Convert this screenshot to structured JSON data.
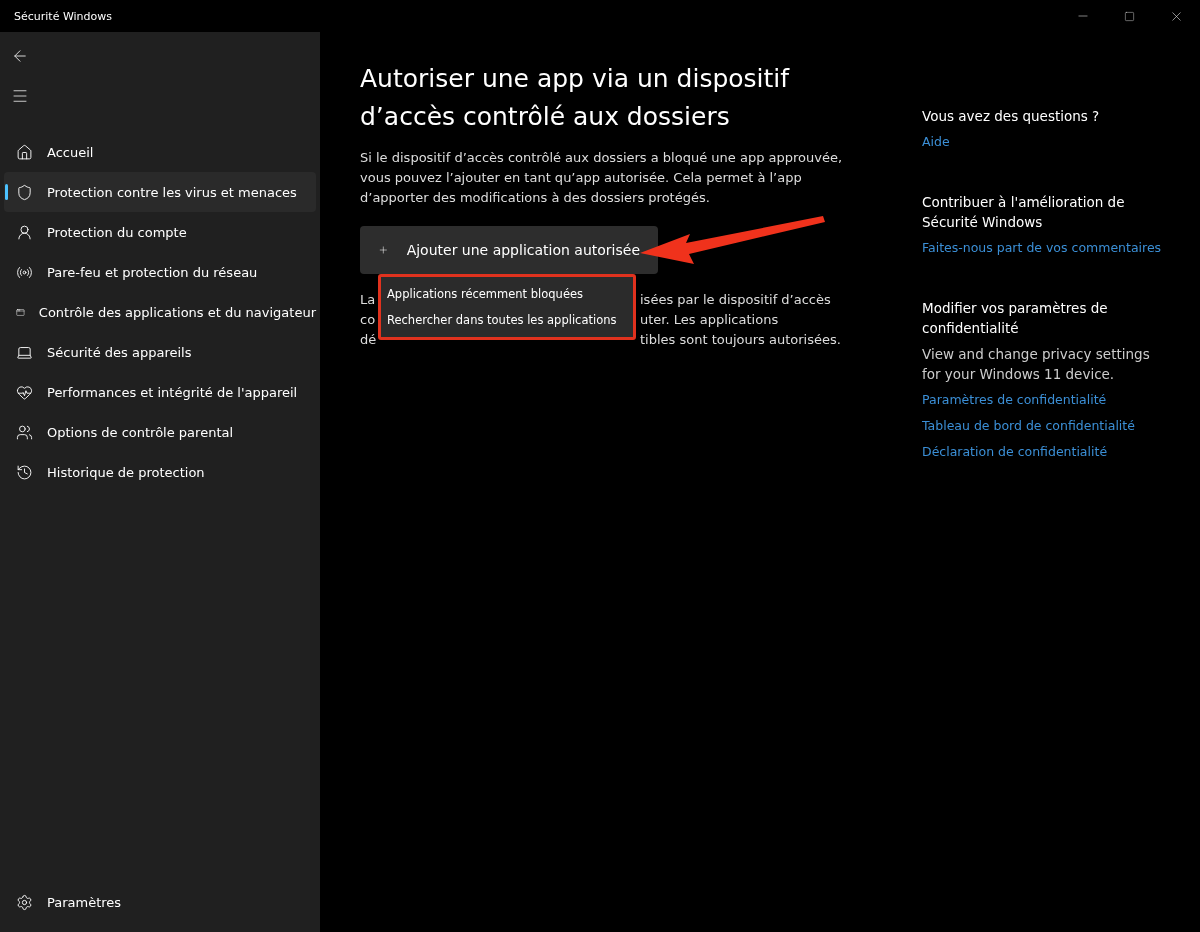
{
  "window": {
    "title": "Sécurité Windows"
  },
  "sidebar": {
    "items": [
      {
        "kind": "home",
        "label": "Accueil",
        "selected": false
      },
      {
        "kind": "shield",
        "label": "Protection contre les virus et menaces",
        "selected": true
      },
      {
        "kind": "account",
        "label": "Protection du compte",
        "selected": false
      },
      {
        "kind": "antenna",
        "label": "Pare-feu et protection du réseau",
        "selected": false
      },
      {
        "kind": "window",
        "label": "Contrôle des applications et du navigateur",
        "selected": false
      },
      {
        "kind": "laptop",
        "label": "Sécurité des appareils",
        "selected": false
      },
      {
        "kind": "heart",
        "label": "Performances et intégrité de l'appareil",
        "selected": false
      },
      {
        "kind": "family",
        "label": "Options de contrôle parental",
        "selected": false
      },
      {
        "kind": "history",
        "label": "Historique de protection",
        "selected": false
      }
    ],
    "settings": {
      "label": "Paramètres"
    }
  },
  "main": {
    "heading": "Autoriser une app via un dispositif d’accès contrôlé aux dossiers",
    "intro": "Si le dispositif d’accès contrôlé aux dossiers a bloqué une app approuvée, vous pouvez l’ajouter en tant qu’app autorisée. Cela permet à l’app d’apporter des modifications à des dossiers protégés.",
    "add_button": {
      "label": "Ajouter une application autorisée"
    },
    "covered_paragraph": [
      {
        "start": "La",
        "end": "isées par le dispositif d’accès"
      },
      {
        "start": "co",
        "end": "uter. Les applications"
      },
      {
        "start": "dé",
        "end": "tibles sont toujours autorisées."
      }
    ],
    "menu": {
      "highlighted": true,
      "items": [
        "Applications récemment bloquées",
        "Rechercher dans toutes les applications"
      ]
    },
    "pointer_arrow": true
  },
  "aside": [
    {
      "title": "Vous avez des questions ?",
      "links": [
        "Aide"
      ]
    },
    {
      "title": "Contribuer à l'amélioration de Sécurité Windows",
      "links": [
        "Faites-nous part de vos commentaires"
      ]
    },
    {
      "title": "Modifier vos paramètres de confidentialité",
      "text": "View and change privacy settings for your Windows 11 device.",
      "links": [
        "Paramètres de confidentialité",
        "Tableau de bord de confidentialité",
        "Déclaration de confidentialité"
      ]
    }
  ]
}
